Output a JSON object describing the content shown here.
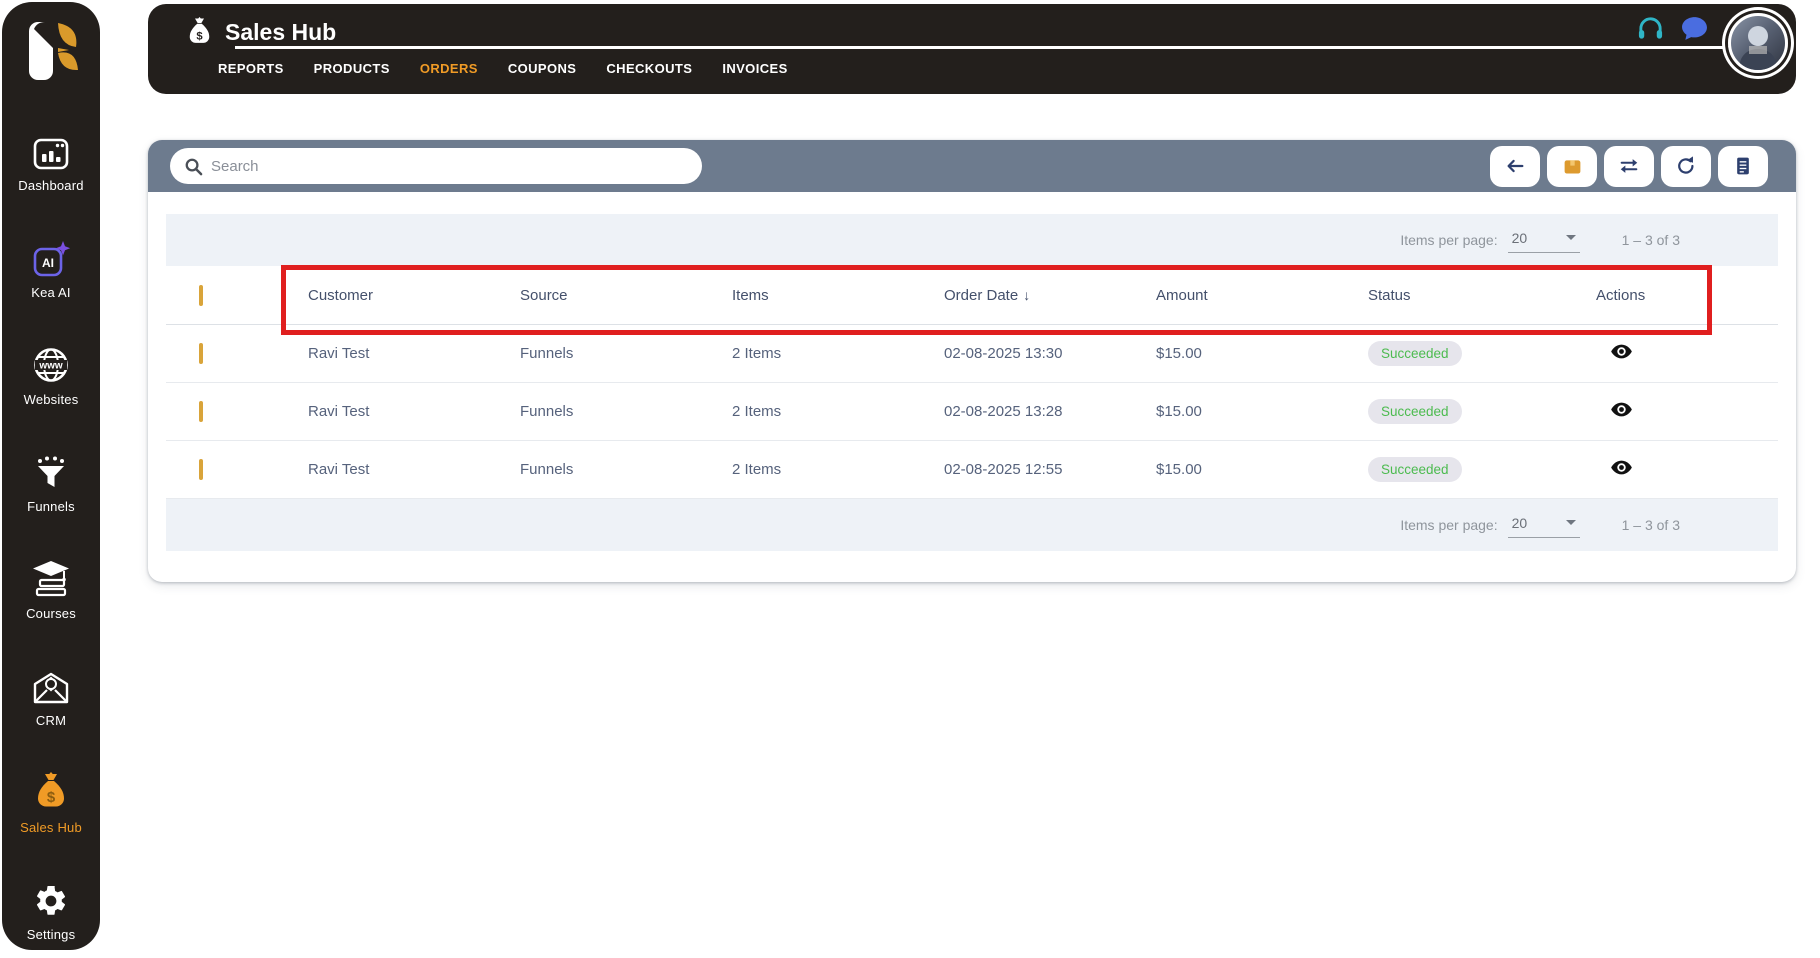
{
  "colors": {
    "sidebar_bg": "#231f1c",
    "accent_orange": "#f09b26",
    "toolbar_slate": "#6d7b8e",
    "strip_gray": "#eef2f7",
    "badge_bg": "#e6e5ec",
    "badge_green": "#4cbb4f",
    "annotation_red": "#e01f1f",
    "icon_navy": "#2d3f6e",
    "headset_teal": "#2fb5c6",
    "chat_blue": "#4a6de0",
    "checkbox_gold": "#d9a43a"
  },
  "sidebar": {
    "logo_icon": "kartra-bird-logo",
    "items": [
      {
        "label": "Dashboard",
        "icon": "dashboard-icon",
        "active": false
      },
      {
        "label": "Kea AI",
        "icon": "kea-ai-icon",
        "active": false
      },
      {
        "label": "Websites",
        "icon": "websites-globe-icon",
        "active": false
      },
      {
        "label": "Funnels",
        "icon": "funnel-icon",
        "active": false
      },
      {
        "label": "Courses",
        "icon": "courses-graduation-icon",
        "active": false
      },
      {
        "label": "CRM",
        "icon": "crm-envelope-icon",
        "active": false
      },
      {
        "label": "Sales Hub",
        "icon": "money-bag-icon",
        "active": true
      },
      {
        "label": "Settings",
        "icon": "gear-icon",
        "active": false
      }
    ]
  },
  "header": {
    "title": "Sales Hub",
    "title_icon": "money-bag-icon",
    "tabs": [
      {
        "label": "REPORTS",
        "active": false
      },
      {
        "label": "PRODUCTS",
        "active": false
      },
      {
        "label": "ORDERS",
        "active": true
      },
      {
        "label": "COUPONS",
        "active": false
      },
      {
        "label": "CHECKOUTS",
        "active": false
      },
      {
        "label": "INVOICES",
        "active": false
      }
    ],
    "right_icons": [
      "headset-icon",
      "chat-bubble-icon",
      "user-avatar"
    ]
  },
  "toolbar": {
    "search_placeholder": "Search",
    "buttons": [
      "back-arrow",
      "package",
      "transfer-arrows",
      "refresh",
      "receipt-list"
    ]
  },
  "pagination": {
    "items_per_page_label": "Items per page:",
    "page_size": "20",
    "range": "1 – 3 of 3"
  },
  "table": {
    "columns": [
      "Customer",
      "Source",
      "Items",
      "Order Date",
      "Amount",
      "Status",
      "Actions"
    ],
    "sort": {
      "column": "Order Date",
      "direction": "desc",
      "indicator": "↓"
    },
    "rows": [
      {
        "customer": "Ravi Test",
        "source": "Funnels",
        "items": "2 Items",
        "date": "02-08-2025 13:30",
        "amount": "$15.00",
        "status": "Succeeded"
      },
      {
        "customer": "Ravi Test",
        "source": "Funnels",
        "items": "2 Items",
        "date": "02-08-2025 13:28",
        "amount": "$15.00",
        "status": "Succeeded"
      },
      {
        "customer": "Ravi Test",
        "source": "Funnels",
        "items": "2 Items",
        "date": "02-08-2025 12:55",
        "amount": "$15.00",
        "status": "Succeeded"
      }
    ]
  },
  "annotation": {
    "type": "highlight-box",
    "target": "table-header-row",
    "color": "#e01f1f"
  }
}
